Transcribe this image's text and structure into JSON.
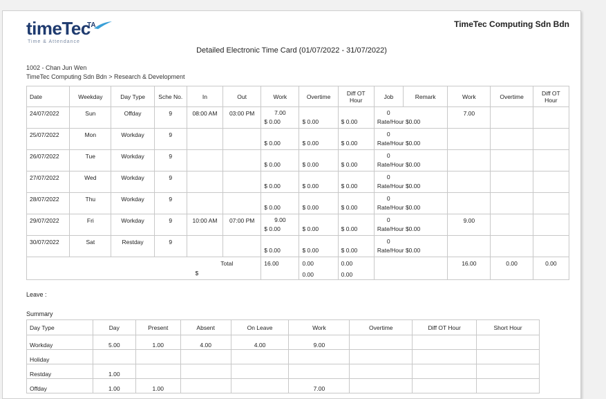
{
  "company": "TimeTec Computing Sdn Bdn",
  "logo": {
    "brand_time": "time",
    "brand_tec": "Tec",
    "brand_ta": "TA",
    "tagline": "Time & Attendance"
  },
  "title": "Detailed Electronic Time Card  (01/07/2022 - 31/07/2022)",
  "employee": {
    "id_name": "1002 - Chan Jun Wen",
    "path": "TimeTec Computing Sdn Bdn > Research & Development"
  },
  "timecard": {
    "headers": [
      "Date",
      "Weekday",
      "Day Type",
      "Sche No.",
      "In",
      "Out",
      "Work",
      "Overtime",
      "Diff OT Hour",
      "Job",
      "Remark",
      "Work",
      "Overtime",
      "Diff OT Hour"
    ],
    "rows": [
      {
        "date": "24/07/2022",
        "weekday": "Sun",
        "daytype": "Offday",
        "sche": "9",
        "in": "08:00 AM",
        "out": "03:00 PM",
        "work_hr": "7.00",
        "work_amt": "$ 0.00",
        "ot_hr": "",
        "ot_amt": "$ 0.00",
        "diff_hr": "",
        "diff_amt": "$ 0.00",
        "job_top": "0",
        "job_bot": "Rate/Hour  $0.00",
        "remark": "",
        "work2": "7.00",
        "ot2": "",
        "diff2": ""
      },
      {
        "date": "25/07/2022",
        "weekday": "Mon",
        "daytype": "Workday",
        "sche": "9",
        "in": "",
        "out": "",
        "work_hr": "",
        "work_amt": "$ 0.00",
        "ot_hr": "",
        "ot_amt": "$ 0.00",
        "diff_hr": "",
        "diff_amt": "$ 0.00",
        "job_top": "0",
        "job_bot": "Rate/Hour  $0.00",
        "remark": "",
        "work2": "",
        "ot2": "",
        "diff2": ""
      },
      {
        "date": "26/07/2022",
        "weekday": "Tue",
        "daytype": "Workday",
        "sche": "9",
        "in": "",
        "out": "",
        "work_hr": "",
        "work_amt": "$ 0.00",
        "ot_hr": "",
        "ot_amt": "$ 0.00",
        "diff_hr": "",
        "diff_amt": "$ 0.00",
        "job_top": "0",
        "job_bot": "Rate/Hour  $0.00",
        "remark": "",
        "work2": "",
        "ot2": "",
        "diff2": ""
      },
      {
        "date": "27/07/2022",
        "weekday": "Wed",
        "daytype": "Workday",
        "sche": "9",
        "in": "",
        "out": "",
        "work_hr": "",
        "work_amt": "$ 0.00",
        "ot_hr": "",
        "ot_amt": "$ 0.00",
        "diff_hr": "",
        "diff_amt": "$ 0.00",
        "job_top": "0",
        "job_bot": "Rate/Hour  $0.00",
        "remark": "",
        "work2": "",
        "ot2": "",
        "diff2": ""
      },
      {
        "date": "28/07/2022",
        "weekday": "Thu",
        "daytype": "Workday",
        "sche": "9",
        "in": "",
        "out": "",
        "work_hr": "",
        "work_amt": "$ 0.00",
        "ot_hr": "",
        "ot_amt": "$ 0.00",
        "diff_hr": "",
        "diff_amt": "$ 0.00",
        "job_top": "0",
        "job_bot": "Rate/Hour  $0.00",
        "remark": "",
        "work2": "",
        "ot2": "",
        "diff2": ""
      },
      {
        "date": "29/07/2022",
        "weekday": "Fri",
        "daytype": "Workday",
        "sche": "9",
        "in": "10:00 AM",
        "out": "07:00 PM",
        "work_hr": "9.00",
        "work_amt": "$ 0.00",
        "ot_hr": "",
        "ot_amt": "$ 0.00",
        "diff_hr": "",
        "diff_amt": "$ 0.00",
        "job_top": "0",
        "job_bot": "Rate/Hour  $0.00",
        "remark": "",
        "work2": "9.00",
        "ot2": "",
        "diff2": ""
      },
      {
        "date": "30/07/2022",
        "weekday": "Sat",
        "daytype": "Restday",
        "sche": "9",
        "in": "",
        "out": "",
        "work_hr": "",
        "work_amt": "$ 0.00",
        "ot_hr": "",
        "ot_amt": "$ 0.00",
        "diff_hr": "",
        "diff_amt": "$ 0.00",
        "job_top": "0",
        "job_bot": "Rate/Hour  $0.00",
        "remark": "",
        "work2": "",
        "ot2": "",
        "diff2": ""
      }
    ],
    "total": {
      "label1": "Total",
      "label2": "$",
      "work_hr": "16.00",
      "ot_hr": "0.00",
      "ot_amt": "0.00",
      "diff_hr": "0.00",
      "diff_amt": "0.00",
      "work2": "16.00",
      "ot2": "0.00",
      "diff2": "0.00"
    }
  },
  "leave_label": "Leave :",
  "summary_label": "Summary",
  "summary": {
    "headers": [
      "Day Type",
      "Day",
      "Present",
      "Absent",
      "On Leave",
      "Work",
      "Overtime",
      "Diff OT Hour",
      "Short Hour"
    ],
    "rows": [
      {
        "type": "Workday",
        "day": "5.00",
        "present": "1.00",
        "absent": "4.00",
        "onleave": "4.00",
        "work": "9.00",
        "ot": "",
        "diff": "",
        "short": ""
      },
      {
        "type": "Holiday",
        "day": "",
        "present": "",
        "absent": "",
        "onleave": "",
        "work": "",
        "ot": "",
        "diff": "",
        "short": ""
      },
      {
        "type": "Restday",
        "day": "1.00",
        "present": "",
        "absent": "",
        "onleave": "",
        "work": "",
        "ot": "",
        "diff": "",
        "short": ""
      },
      {
        "type": "Offday",
        "day": "1.00",
        "present": "1.00",
        "absent": "",
        "onleave": "",
        "work": "7.00",
        "ot": "",
        "diff": "",
        "short": ""
      }
    ]
  }
}
